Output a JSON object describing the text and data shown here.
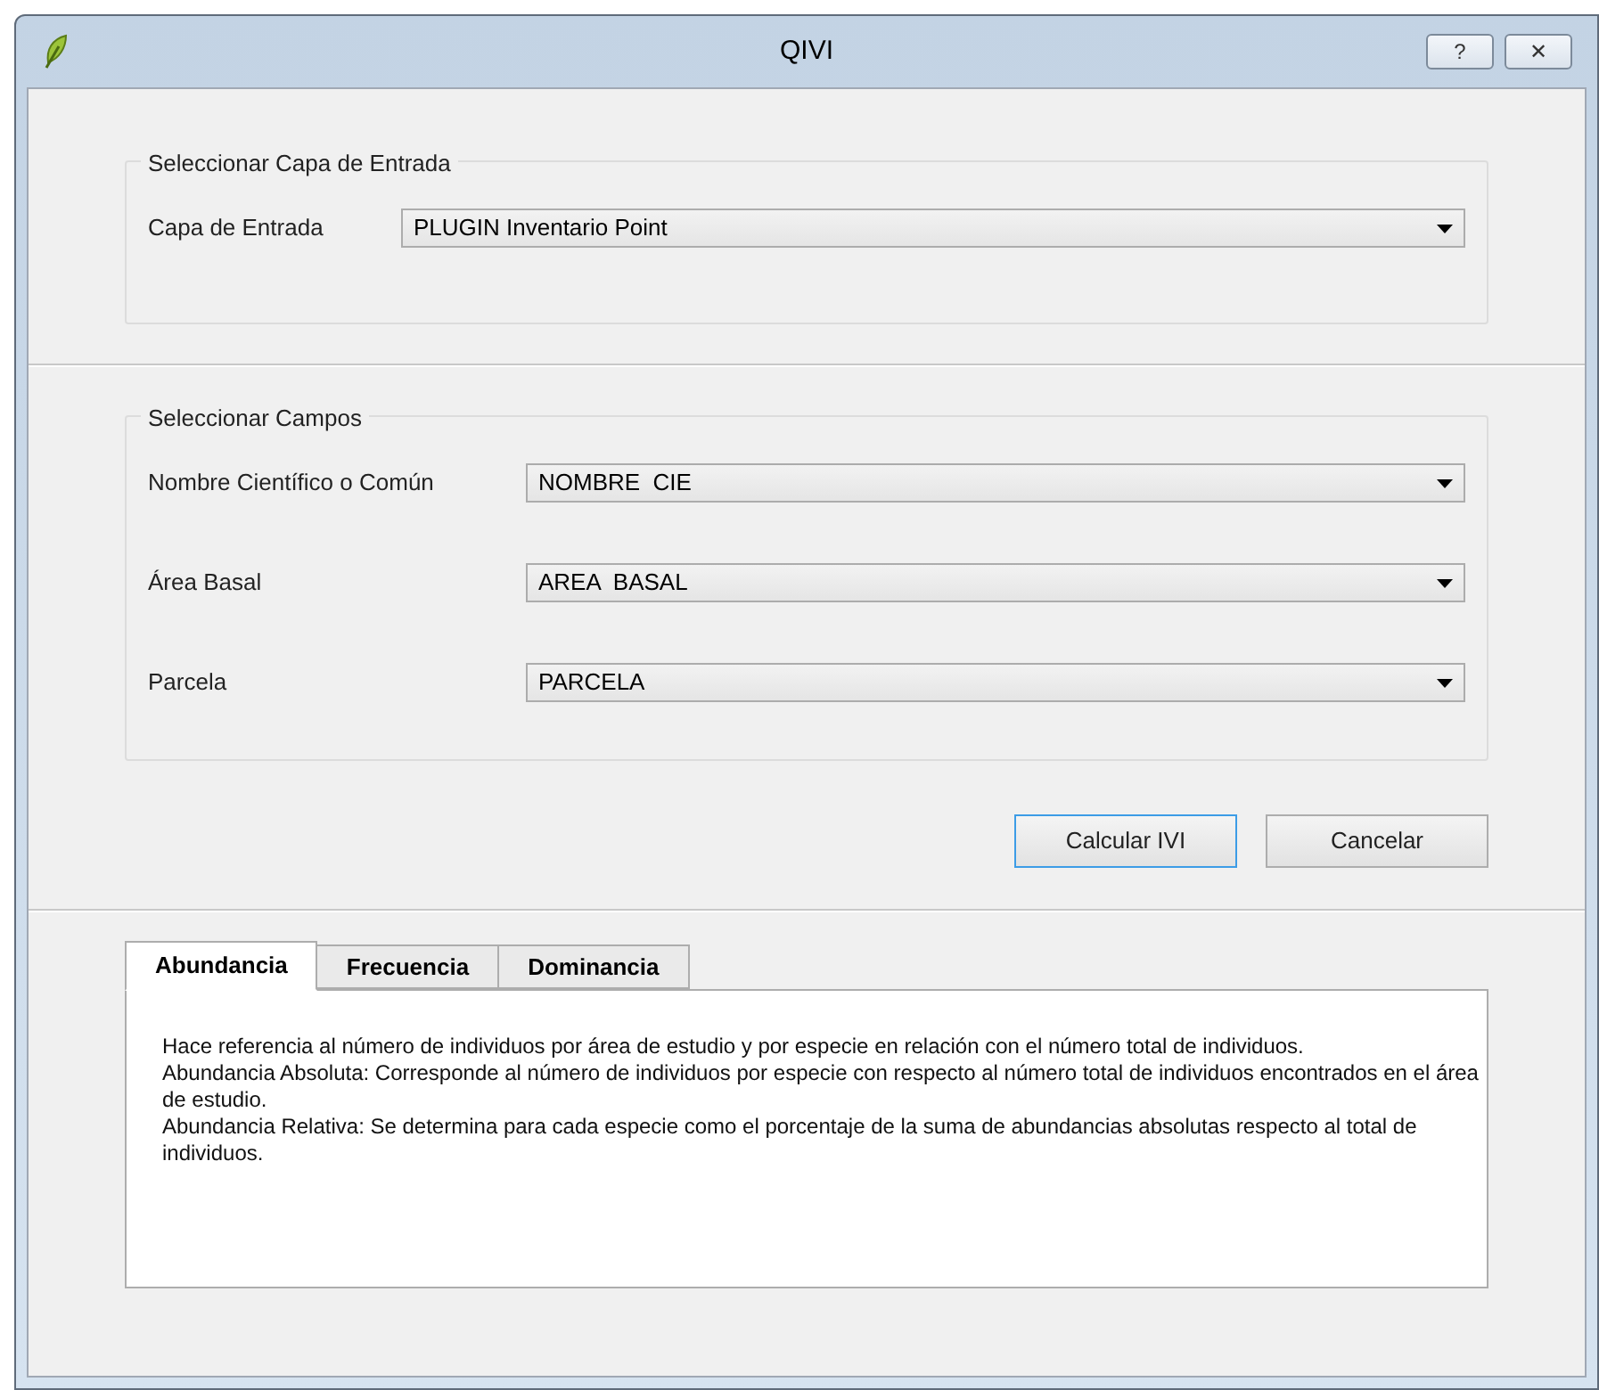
{
  "window": {
    "title": "QIVI",
    "controls": [
      {
        "label": "?"
      },
      {
        "label": "✕"
      }
    ]
  },
  "input_group": {
    "title": "Seleccionar Capa de Entrada",
    "fields": [
      {
        "label": "Capa de Entrada",
        "value": "PLUGIN Inventario Point"
      }
    ]
  },
  "fields_group": {
    "title": "Seleccionar Campos",
    "fields": [
      {
        "label": "Nombre Científico o Común",
        "value": "NOMBRE  CIE"
      },
      {
        "label": "Área Basal",
        "value": "AREA  BASAL"
      },
      {
        "label": "Parcela",
        "value": "PARCELA"
      }
    ]
  },
  "buttons": [
    {
      "label": "Calcular IVI",
      "default": true
    },
    {
      "label": "Cancelar",
      "default": false
    }
  ],
  "tabs": [
    {
      "label": "Abundancia",
      "selected": true
    },
    {
      "label": "Frecuencia",
      "selected": false
    },
    {
      "label": "Dominancia",
      "selected": false
    }
  ],
  "description": [
    "Hace referencia al número de individuos por área de estudio y por especie en relación con el número total de individuos.",
    "Abundancia Absoluta: Corresponde al número de individuos por especie con respecto al número total de individuos encontrados en el área de estudio.",
    "Abundancia Relativa: Se determina para cada especie como el porcentaje de la suma de abundancias absolutas respecto al total de individuos."
  ]
}
